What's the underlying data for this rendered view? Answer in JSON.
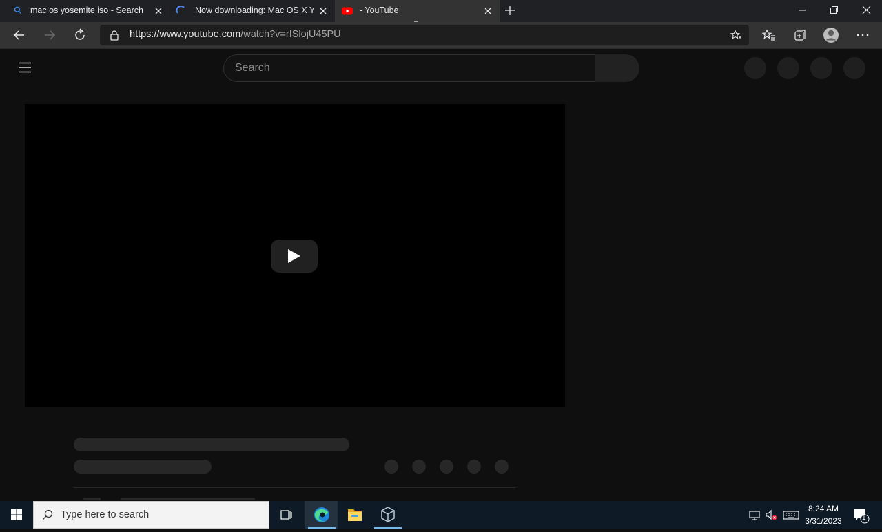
{
  "browser": {
    "tabs": [
      {
        "title": "mac os yosemite iso - Search",
        "icon": "search-icon",
        "active": false
      },
      {
        "title": "Now downloading: Mac OS X Yo",
        "icon": "loading-spinner-icon",
        "active": false
      },
      {
        "title": "- YouTube",
        "icon": "youtube-icon",
        "active": true
      }
    ],
    "url_host": "https://www.youtube.com",
    "url_path": "/watch?v=rISlojU45PU",
    "colors": {
      "tabbar": "#202124",
      "active_tab": "#333333",
      "accent": "#76b9ed"
    }
  },
  "youtube": {
    "search_placeholder": "Search",
    "brand_red": "#ff0000"
  },
  "taskbar": {
    "search_placeholder": "Type here to search",
    "time": "8:24 AM",
    "date": "3/31/2023",
    "notification_count": "1",
    "pinned_apps": [
      "task-view-icon",
      "edge-icon",
      "file-explorer-icon",
      "virtualbox-icon"
    ]
  }
}
